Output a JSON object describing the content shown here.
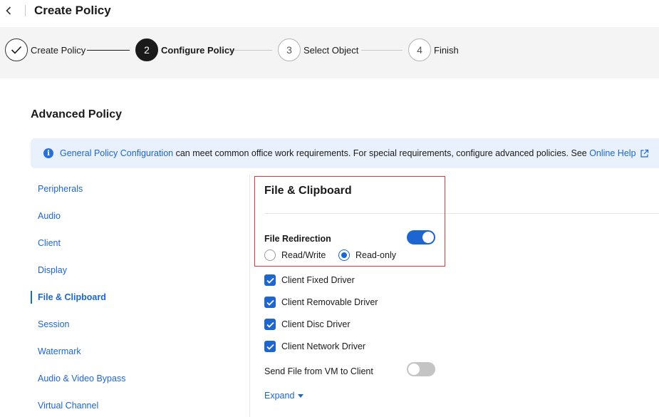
{
  "header": {
    "title": "Create Policy"
  },
  "steps": [
    {
      "number": "",
      "label": "Create Policy",
      "state": "done"
    },
    {
      "number": "2",
      "label": "Configure Policy",
      "state": "active"
    },
    {
      "number": "3",
      "label": "Select Object",
      "state": "pending"
    },
    {
      "number": "4",
      "label": "Finish",
      "state": "pending"
    }
  ],
  "main": {
    "section_title": "Advanced Policy",
    "banner": {
      "link_text": "General Policy Configuration",
      "text": " can meet common office work requirements. For special requirements, configure advanced policies. See ",
      "help_link": "Online Help"
    },
    "nav": {
      "items": [
        {
          "label": "Peripherals"
        },
        {
          "label": "Audio"
        },
        {
          "label": "Client"
        },
        {
          "label": "Display"
        },
        {
          "label": "File & Clipboard"
        },
        {
          "label": "Session"
        },
        {
          "label": "Watermark"
        },
        {
          "label": "Audio & Video Bypass"
        },
        {
          "label": "Virtual Channel"
        }
      ],
      "active_index": 4
    },
    "content": {
      "title": "File & Clipboard",
      "file_redirection": {
        "label": "File Redirection",
        "enabled": true,
        "options": [
          {
            "label": "Read/Write",
            "checked": false
          },
          {
            "label": "Read-only",
            "checked": true
          }
        ]
      },
      "drivers": [
        {
          "label": "Client Fixed Driver",
          "checked": true
        },
        {
          "label": "Client Removable Driver",
          "checked": true
        },
        {
          "label": "Client Disc Driver",
          "checked": true
        },
        {
          "label": "Client Network Driver",
          "checked": true
        }
      ],
      "send_file": {
        "label": "Send File from VM to Client",
        "enabled": false
      },
      "expand_label": "Expand"
    }
  },
  "colors": {
    "accent": "#1d66d1",
    "highlight_border": "#d63a3a",
    "steps_bg": "#f4f4f4",
    "banner_bg": "#e8f1fc"
  }
}
